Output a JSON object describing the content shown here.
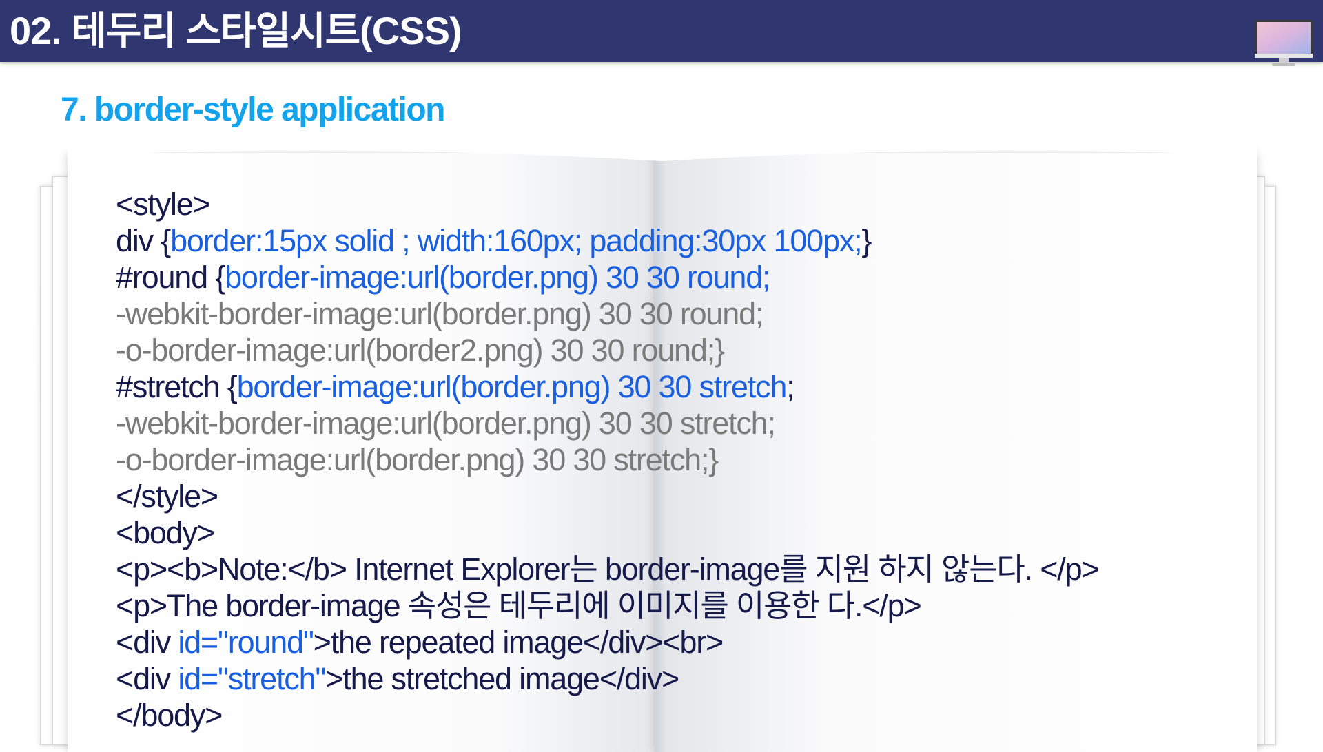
{
  "header": {
    "title": "02. 테두리 스타일시트(CSS)",
    "icon": "monitor-icon",
    "color": "#2f3670"
  },
  "subtitle": "7. border-style application",
  "colors": {
    "accent": "#13a3ec",
    "code_default": "#151a4a",
    "code_blue": "#1a5fe0",
    "code_gray": "#7a7a7a"
  },
  "code_lines": [
    [
      {
        "t": "<style>",
        "c": "k"
      }
    ],
    [
      {
        "t": "div {",
        "c": "k"
      },
      {
        "t": "border:15px solid ; width:160px; padding:30px 100px;",
        "c": "b"
      },
      {
        "t": "}",
        "c": "k"
      }
    ],
    [
      {
        "t": "#round {",
        "c": "k"
      },
      {
        "t": "border-image:url(border.png) 30 30 round;",
        "c": "b"
      }
    ],
    [
      {
        "t": "-webkit-border-image:url(border.png) 30 30 round;",
        "c": "g"
      }
    ],
    [
      {
        "t": "-o-border-image:url(border2.png) 30 30 round;}",
        "c": "g"
      }
    ],
    [
      {
        "t": "#stretch {",
        "c": "k"
      },
      {
        "t": "border-image:url(border.png) 30 30 stretch",
        "c": "b"
      },
      {
        "t": ";",
        "c": "k"
      }
    ],
    [
      {
        "t": "-webkit-border-image:url(border.png) 30 30 stretch;",
        "c": "g"
      }
    ],
    [
      {
        "t": "-o-border-image:url(border.png) 30 30 stretch;}",
        "c": "g"
      }
    ],
    [
      {
        "t": "</style>",
        "c": "k"
      }
    ],
    [
      {
        "t": "<body>",
        "c": "k"
      }
    ],
    [
      {
        "t": "<p><b>Note:</b> Internet Explorer는 border-image를 지원 하지 않는다. </p>",
        "c": "k"
      }
    ],
    [
      {
        "t": "<p>The border-image 속성은 테두리에 이미지를 이용한 다.</p>",
        "c": "k"
      }
    ],
    [
      {
        "t": "<div ",
        "c": "k"
      },
      {
        "t": "id=\"round\"",
        "c": "b"
      },
      {
        "t": ">the repeated image</div><br>",
        "c": "k"
      }
    ],
    [
      {
        "t": "<div ",
        "c": "k"
      },
      {
        "t": "id=\"stretch\"",
        "c": "b"
      },
      {
        "t": ">the stretched image</div>",
        "c": "k"
      }
    ],
    [
      {
        "t": "</body>",
        "c": "k"
      }
    ]
  ]
}
